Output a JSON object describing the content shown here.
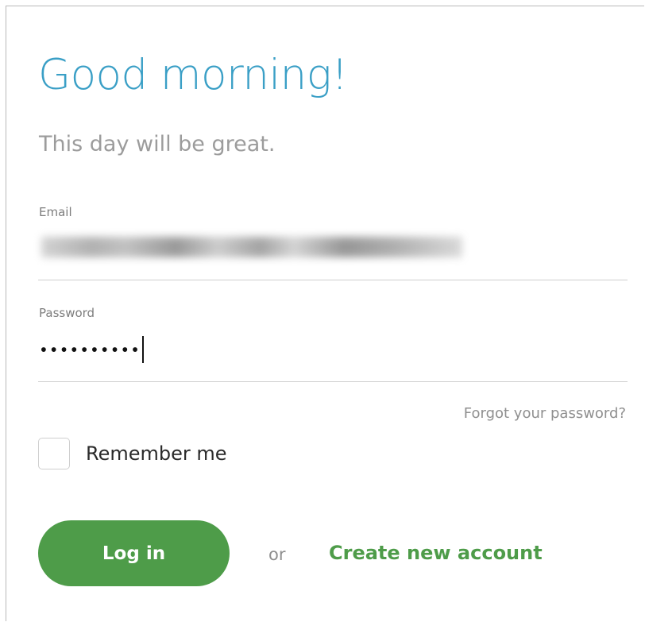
{
  "header": {
    "title": "Good morning!",
    "subtitle": "This day will be great."
  },
  "form": {
    "email": {
      "label": "Email",
      "value": "",
      "placeholder": ""
    },
    "password": {
      "label": "Password",
      "masked_value": "••••••••••"
    },
    "forgot_password_label": "Forgot your password?",
    "remember_me_label": "Remember me",
    "remember_me_checked": false
  },
  "actions": {
    "login_label": "Log in",
    "or_label": "or",
    "create_account_label": "Create new account"
  },
  "colors": {
    "title": "#3a9fc6",
    "primary_green": "#4e9c49",
    "muted_text": "#8f8f8f",
    "divider": "#cfcfcf"
  }
}
